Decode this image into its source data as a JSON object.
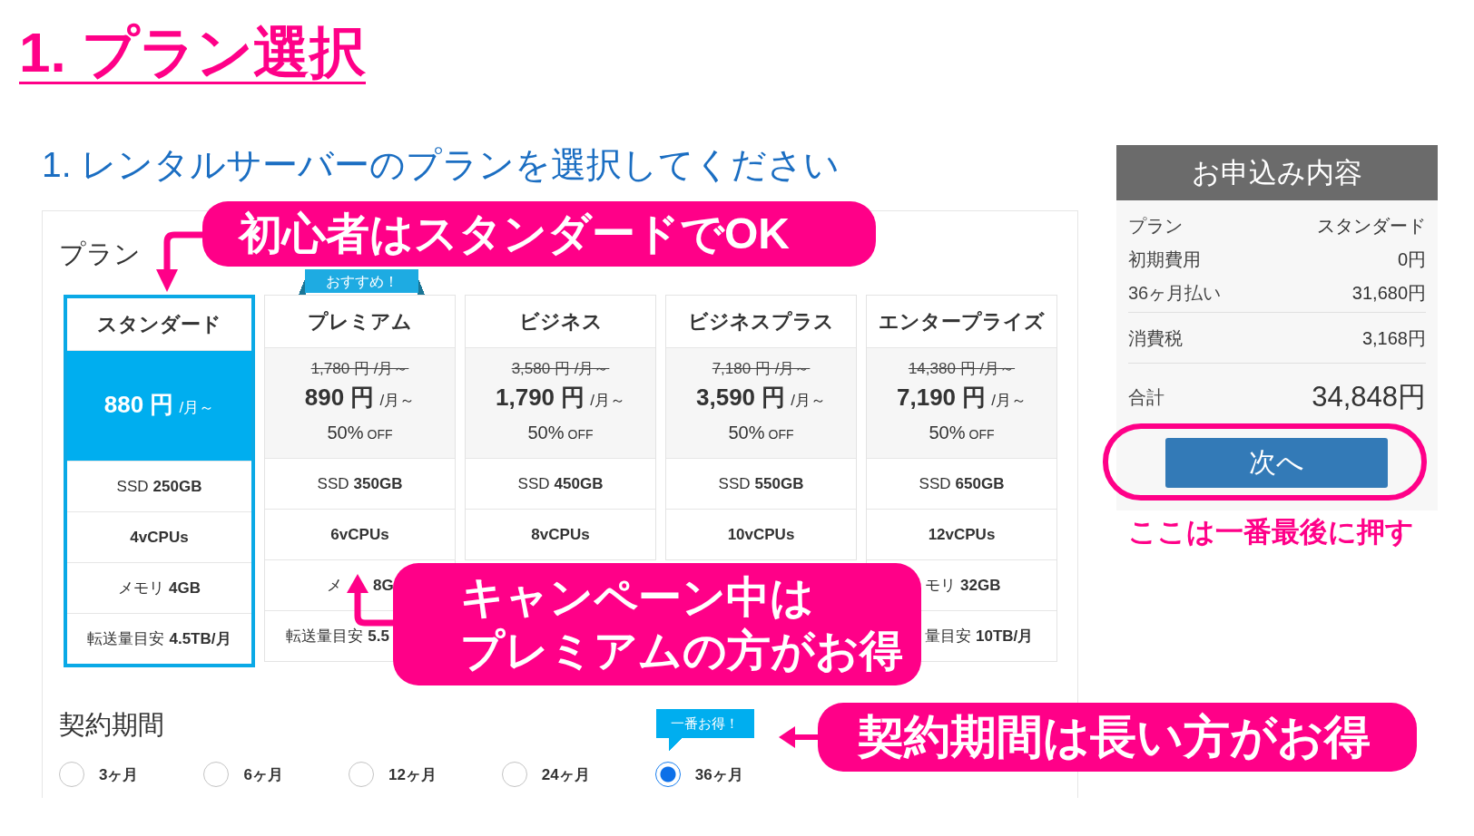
{
  "page_title": "1. プラン選択",
  "step_heading": "1. レンタルサーバーのプランを選択してください",
  "plan_section": {
    "label": "プラン",
    "plans": [
      {
        "name": "スタンダード",
        "selected": true,
        "price": "880 円",
        "price_unit": "/月～",
        "specs": [
          {
            "label": "SSD",
            "value": "250GB"
          },
          {
            "value": "4vCPUs"
          },
          {
            "label": "メモリ",
            "value": "4GB"
          },
          {
            "label": "転送量目安",
            "value": "4.5TB/月"
          }
        ]
      },
      {
        "name": "プレミアム",
        "selected": false,
        "ribbon": "おすすめ！",
        "old_price": "1,780 円 /月～",
        "price": "890 円",
        "price_unit": "/月～",
        "discount": "50%",
        "discount_unit": "OFF",
        "specs": [
          {
            "label": "SSD",
            "value": "350GB"
          },
          {
            "value": "6vCPUs"
          },
          {
            "label": "メ",
            "value": "8G"
          },
          {
            "label": "転送量目安",
            "value": "5.5"
          }
        ]
      },
      {
        "name": "ビジネス",
        "selected": false,
        "old_price": "3,580 円 /月～",
        "price": "1,790 円",
        "price_unit": "/月～",
        "discount": "50%",
        "discount_unit": "OFF",
        "specs": [
          {
            "label": "SSD",
            "value": "450GB"
          },
          {
            "value": "8vCPUs"
          }
        ]
      },
      {
        "name": "ビジネスプラス",
        "selected": false,
        "old_price": "7,180 円 /月～",
        "price": "3,590 円",
        "price_unit": "/月～",
        "discount": "50%",
        "discount_unit": "OFF",
        "specs": [
          {
            "label": "SSD",
            "value": "550GB"
          },
          {
            "value": "10vCPUs"
          }
        ]
      },
      {
        "name": "エンタープライズ",
        "selected": false,
        "old_price": "14,380 円 /月～",
        "price": "7,190 円",
        "price_unit": "/月～",
        "discount": "50%",
        "discount_unit": "OFF",
        "specs": [
          {
            "label": "SSD",
            "value": "650GB"
          },
          {
            "value": "12vCPUs"
          },
          {
            "label": "モリ",
            "value": "32GB"
          },
          {
            "label": "量目安",
            "value": "10TB/月"
          }
        ]
      }
    ]
  },
  "contract_period": {
    "label": "契約期間",
    "options": [
      {
        "label": "3ヶ月",
        "selected": false
      },
      {
        "label": "6ヶ月",
        "selected": false
      },
      {
        "label": "12ヶ月",
        "selected": false
      },
      {
        "label": "24ヶ月",
        "selected": false
      },
      {
        "label": "36ヶ月",
        "selected": true,
        "badge": "一番お得！"
      }
    ]
  },
  "order_summary": {
    "title": "お申込み内容",
    "sections": [
      {
        "kind": "item",
        "rows": [
          {
            "label": "プラン",
            "value": "スタンダード"
          },
          {
            "label": "初期費用",
            "value": "0円"
          },
          {
            "label": "36ヶ月払い",
            "value": "31,680円"
          }
        ]
      },
      {
        "kind": "item",
        "rows": [
          {
            "label": "消費税",
            "value": "3,168円"
          }
        ]
      },
      {
        "kind": "total",
        "rows": [
          {
            "label": "合計",
            "value": "34,848円"
          }
        ]
      }
    ],
    "next_button": "次へ"
  },
  "annotations": {
    "callouts": [
      {
        "lines": [
          "初心者はスタンダードでOK"
        ]
      },
      {
        "lines": [
          "キャンペーン中は",
          "プレミアムの方がお得"
        ]
      },
      {
        "lines": [
          "契約期間は長い方がお得"
        ]
      }
    ],
    "note": "ここは一番最後に押す"
  }
}
